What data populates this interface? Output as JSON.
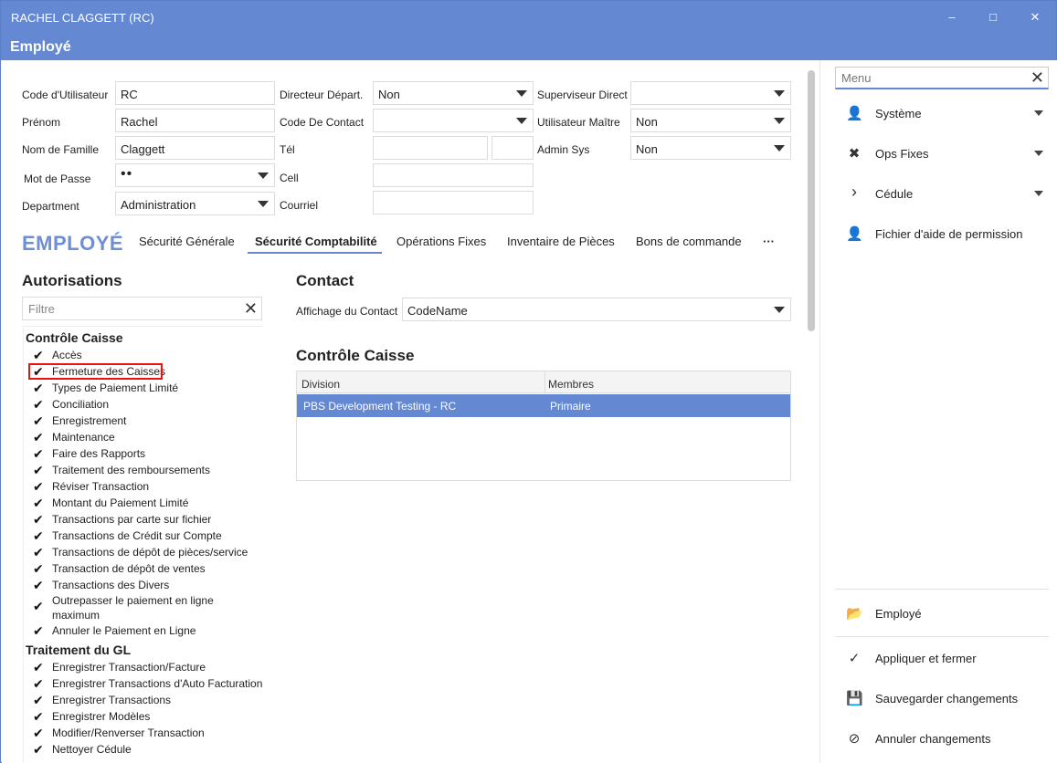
{
  "window": {
    "title": "RACHEL CLAGGETT (RC)",
    "subtitle": "Employé",
    "min_icon": "minimize-icon",
    "max_icon": "maximize-icon",
    "close_icon": "close-icon"
  },
  "form": {
    "user_code_label": "Code d'Utilisateur",
    "user_code": "RC",
    "first_name_label": "Prénom",
    "first_name": "Rachel",
    "last_name_label": "Nom de Famille",
    "last_name": "Claggett",
    "password_label": "Mot de Passe",
    "password": "••",
    "department_label": "Department",
    "department": "Administration",
    "dept_director_label": "Directeur Départ.",
    "dept_director": "Non",
    "contact_code_label": "Code De Contact",
    "contact_code": "",
    "tel_label": "Tél",
    "tel": "",
    "tel_ext": "",
    "cell_label": "Cell",
    "cell": "",
    "email_label": "Courriel",
    "email": "",
    "direct_supervisor_label": "Superviseur Direct",
    "direct_supervisor": "",
    "master_user_label": "Utilisateur Maître",
    "master_user": "Non",
    "sys_admin_label": "Admin Sys",
    "sys_admin": "Non"
  },
  "section_title": "EMPLOYÉ",
  "tabs": [
    {
      "label": "Sécurité Générale"
    },
    {
      "label": "Sécurité Comptabilité"
    },
    {
      "label": "Opérations Fixes"
    },
    {
      "label": "Inventaire de Pièces"
    },
    {
      "label": "Bons de commande"
    },
    {
      "label": "···"
    }
  ],
  "active_tab": "Sécurité Comptabilité",
  "authorisations": {
    "title": "Autorisations",
    "filter_placeholder": "Filtre",
    "groups": [
      {
        "name": "Contrôle Caisse",
        "items": [
          "Accès",
          "Fermeture des Caisses",
          "Types de Paiement Limité",
          "Conciliation",
          "Enregistrement",
          "Maintenance",
          "Faire des Rapports",
          "Traitement des remboursements",
          "Réviser Transaction",
          "Montant du Paiement Limité",
          "Transactions par carte sur fichier",
          "Transactions de Crédit sur Compte",
          "Transactions de dépôt de pièces/service",
          "Transaction de dépôt de ventes",
          "Transactions des Divers",
          "Outrepasser le paiement en ligne maximum",
          "Annuler le Paiement en Ligne"
        ]
      },
      {
        "name": "Traitement du GL",
        "items": [
          "Enregistrer Transaction/Facture",
          "Enregistrer Transactions d'Auto Facturation",
          "Enregistrer Transactions",
          "Enregistrer Modèles",
          "Modifier/Renverser Transaction",
          "Nettoyer Cédule"
        ]
      }
    ],
    "check_glyph": "✔",
    "highlighted_item": "Fermeture des Caisses"
  },
  "contact": {
    "title": "Contact",
    "display_label": "Affichage du Contact",
    "display_value": "CodeName"
  },
  "cash_control": {
    "title": "Contrôle Caisse",
    "columns": [
      "Division",
      "Membres"
    ],
    "rows": [
      {
        "division": "PBS Development Testing - RC",
        "members": "Primaire"
      }
    ]
  },
  "side_menu": {
    "search_placeholder": "Menu",
    "items": [
      {
        "label": "Système",
        "icon": "user-cog-icon"
      },
      {
        "label": "Ops Fixes",
        "icon": "tools-icon"
      },
      {
        "label": "Cédule",
        "icon": "chevron-right-icon"
      },
      {
        "label": "Fichier d'aide de permission",
        "icon": "user-cog-icon"
      }
    ],
    "bottom_items": [
      {
        "label": "Employé",
        "icon": "folder-open-icon"
      },
      {
        "label": "Appliquer et fermer",
        "icon": "check-icon"
      },
      {
        "label": "Sauvegarder changements",
        "icon": "save-icon"
      },
      {
        "label": "Annuler changements",
        "icon": "cancel-icon"
      }
    ]
  },
  "colors": {
    "accent": "#6488d2",
    "section_title": "#6d8fd6",
    "highlight_border": "#e11111"
  }
}
